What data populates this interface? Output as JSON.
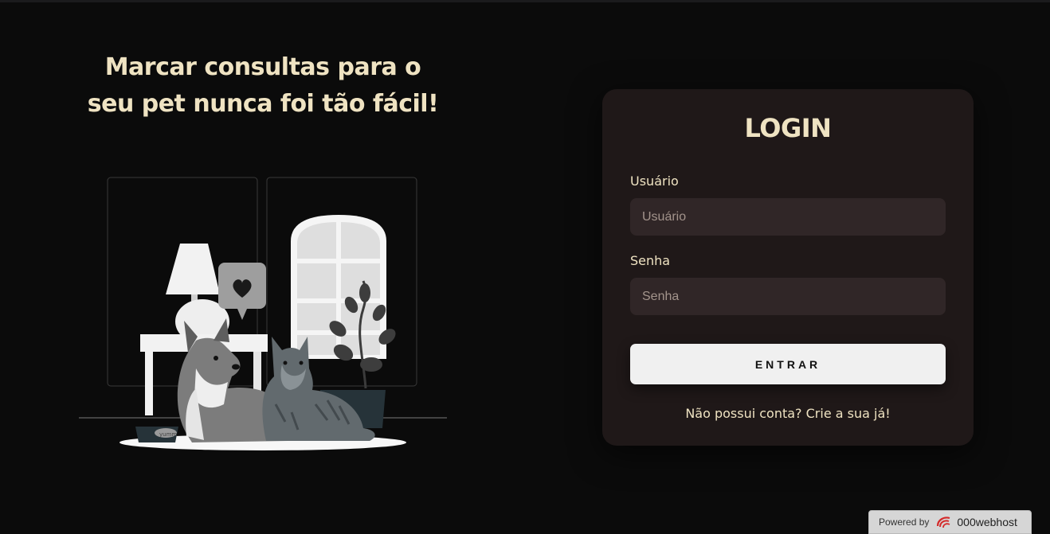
{
  "hero": {
    "title_line1": "Marcar consultas para o",
    "title_line2": "seu pet nunca foi tão fácil!",
    "illustration": {
      "icon": "heart-icon",
      "bowl_label": "yumm"
    }
  },
  "login": {
    "title": "LOGIN",
    "username": {
      "label": "Usuário",
      "placeholder": "Usuário",
      "value": ""
    },
    "password": {
      "label": "Senha",
      "placeholder": "Senha",
      "value": ""
    },
    "submit_label": "ENTRAR",
    "signup_link": "Não possui conta? Crie a sua já!"
  },
  "footer": {
    "powered_by": "Powered by",
    "brand": "000webhost",
    "brand_icon": "000webhost-logo-icon"
  },
  "colors": {
    "background": "#0b0b0b",
    "accent_text": "#efe3c2",
    "card": "#1f1818",
    "input": "#302627",
    "button": "#f0f0f0"
  }
}
